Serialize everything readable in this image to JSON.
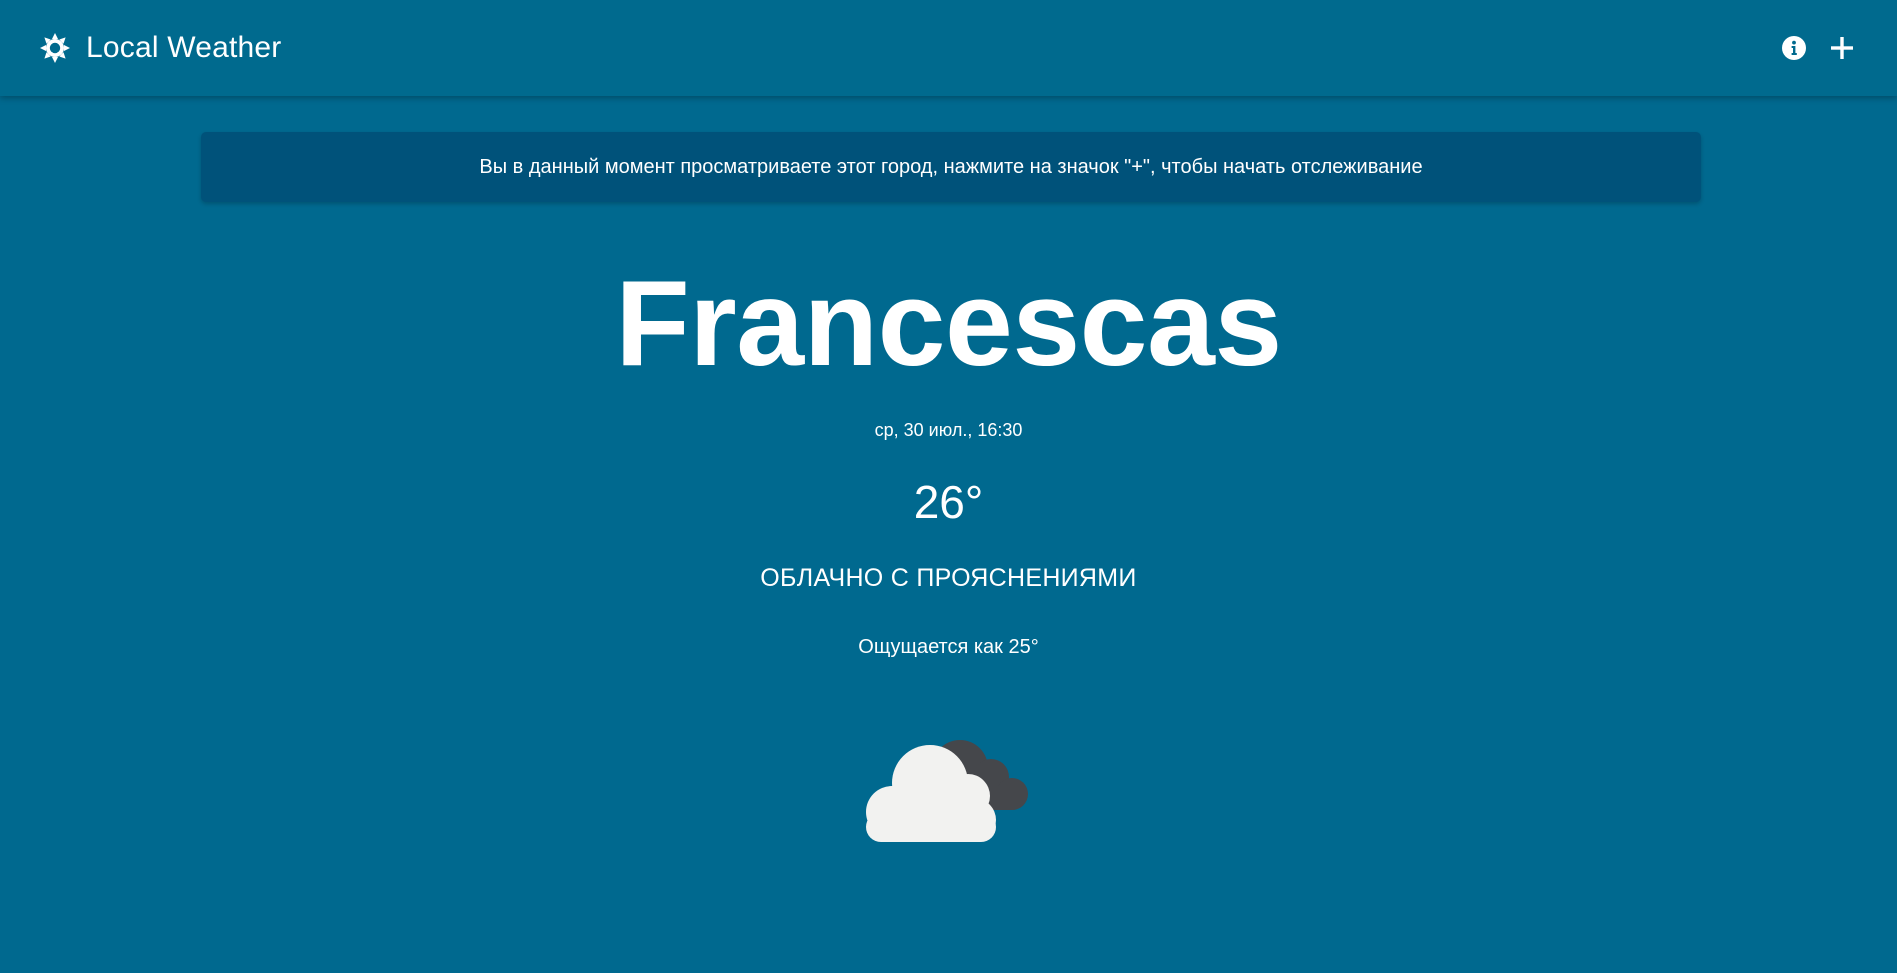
{
  "header": {
    "title": "Local Weather",
    "logo_icon": "sun-icon",
    "info_icon": "info-icon",
    "add_icon": "plus-icon"
  },
  "banner": {
    "text": "Вы в данный момент просматриваете этот город, нажмите на значок \"+\", чтобы начать отслеживание"
  },
  "weather": {
    "city": "Francescas",
    "datetime": "ср, 30 июл., 16:30",
    "temperature": "26°",
    "condition": "ОБЛАЧНО С ПРОЯСНЕНИЯМИ",
    "feels_like": "Ощущается как 25°",
    "icon": "partly-cloudy-icon"
  },
  "colors": {
    "background": "#00698f",
    "banner": "#00527a",
    "cloud_light": "#f2f2f0",
    "cloud_dark": "#45474b"
  }
}
